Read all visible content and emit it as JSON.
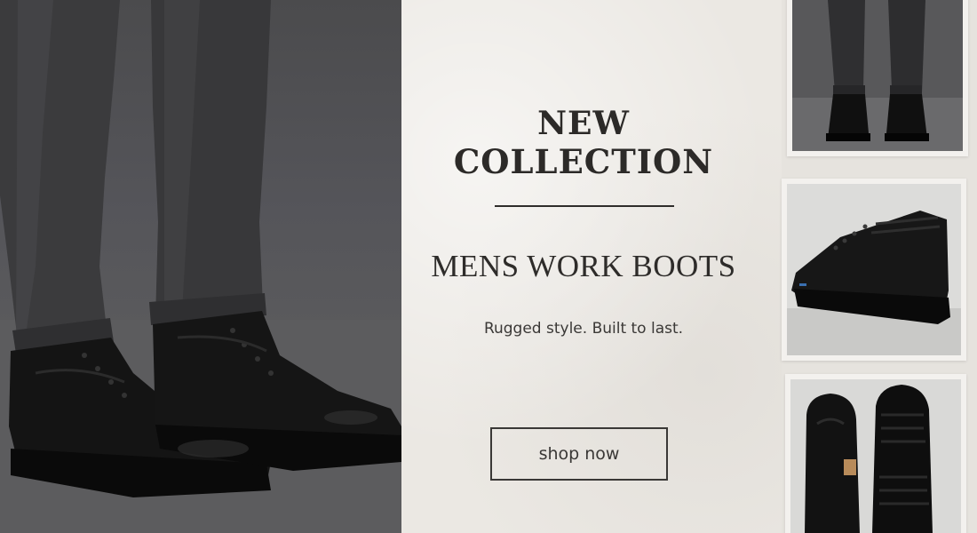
{
  "banner": {
    "headline_line1": "NEW",
    "headline_line2": "COLLECTION",
    "subtitle": "MENS WORK BOOTS",
    "tagline": "Rugged style. Built to last.",
    "cta_label": "shop now"
  },
  "images": {
    "hero": "boots-on-model-photo",
    "thumb_front": "boots-front-view-photo",
    "thumb_side": "boot-side-view-photo",
    "thumb_top": "boots-top-and-sole-photo"
  },
  "colors": {
    "paper": "#ebe8e3",
    "ink": "#2c2a28",
    "leather": "#121212",
    "denim": "#3e3e40"
  }
}
